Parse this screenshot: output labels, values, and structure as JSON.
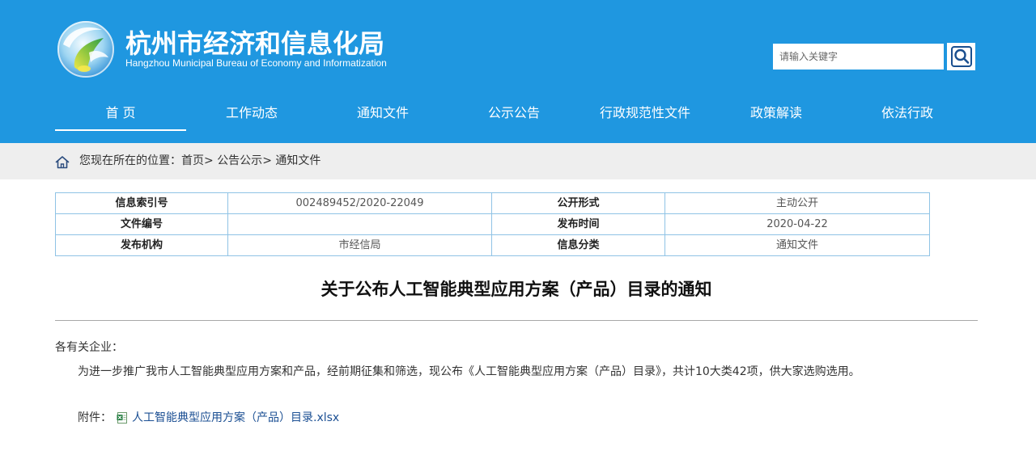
{
  "colors": {
    "header_background": "#1f97e0",
    "breadcrumb_background": "#eeeeee",
    "table_border": "#8fc3e5",
    "link": "#1b4f93",
    "divider": "#a8a8a8"
  },
  "header": {
    "logo_icon": "bureau-logo-icon",
    "title": "杭州市经济和信息化局",
    "subtitle": "Hangzhou Municipal Bureau of Economy and Informatization",
    "search": {
      "placeholder": "请输入关键字",
      "value": "",
      "button_icon": "search-icon"
    }
  },
  "nav": {
    "items": [
      {
        "label": "首 页",
        "active": true
      },
      {
        "label": "工作动态",
        "active": false
      },
      {
        "label": "通知文件",
        "active": false
      },
      {
        "label": "公示公告",
        "active": false
      },
      {
        "label": "行政规范性文件",
        "active": false
      },
      {
        "label": "政策解读",
        "active": false
      },
      {
        "label": "依法行政",
        "active": false
      }
    ]
  },
  "breadcrumb": {
    "icon": "home-icon",
    "label": "您现在所在的位置：",
    "items": [
      "首页",
      "公告公示",
      "通知文件"
    ],
    "separator": "> "
  },
  "info_table": {
    "rows": [
      [
        {
          "label": "信息索引号",
          "value": "002489452/2020-22049"
        },
        {
          "label": "公开形式",
          "value": "主动公开"
        }
      ],
      [
        {
          "label": "文件编号",
          "value": ""
        },
        {
          "label": "发布时间",
          "value": "2020-04-22"
        }
      ],
      [
        {
          "label": "发布机构",
          "value": "市经信局"
        },
        {
          "label": "信息分类",
          "value": "通知文件"
        }
      ]
    ]
  },
  "article": {
    "title": "关于公布人工智能典型应用方案（产品）目录的通知",
    "salutation": "各有关企业：",
    "body": "为进一步推广我市人工智能典型应用方案和产品，经前期征集和筛选，现公布《人工智能典型应用方案（产品）目录》，共计10大类42项，供大家选购选用。",
    "attachment": {
      "label": "附件：",
      "icon": "excel-file-icon",
      "file_name": "人工智能典型应用方案（产品）目录.xlsx"
    }
  }
}
